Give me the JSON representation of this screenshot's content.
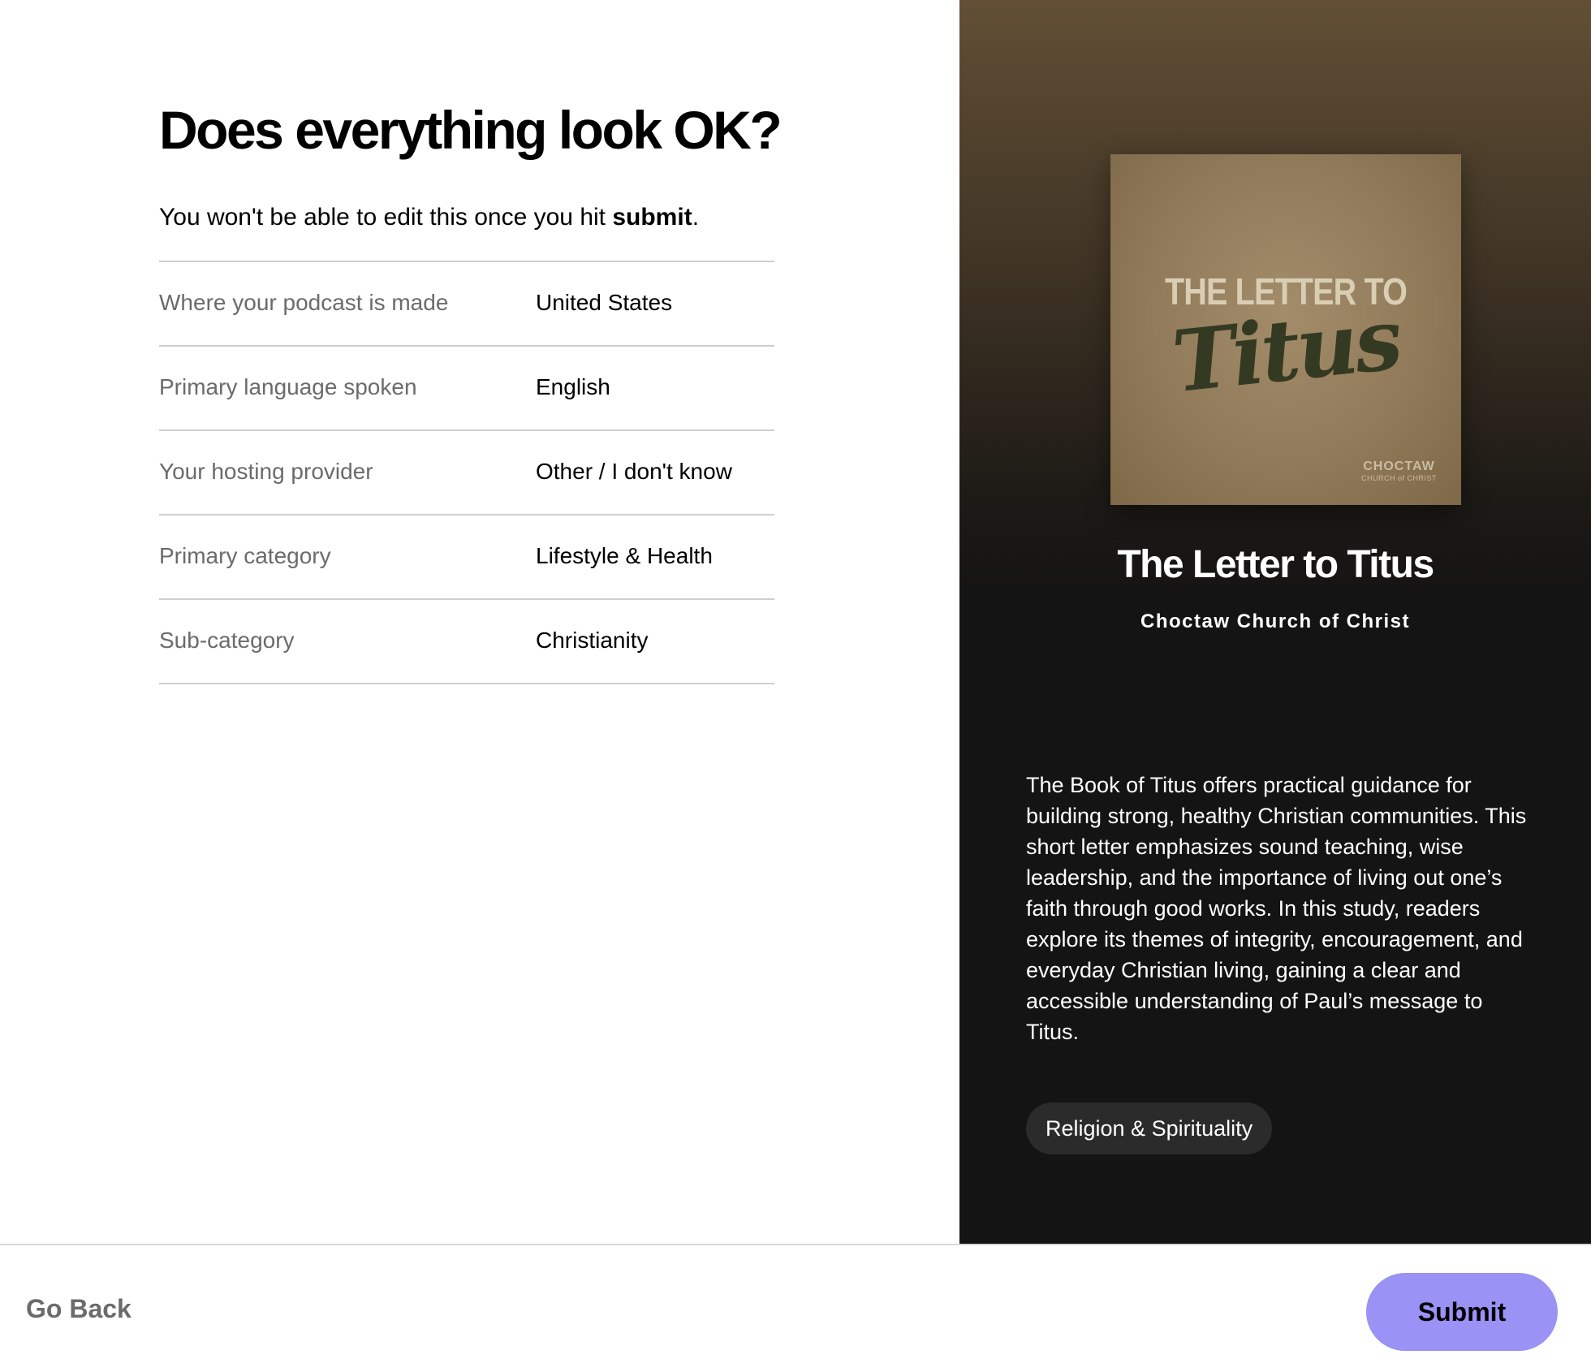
{
  "page": {
    "title": "Does everything look OK?",
    "subtitle_prefix": "You won't be able to edit this once you hit ",
    "subtitle_bold": "submit",
    "subtitle_suffix": "."
  },
  "summary_rows": [
    {
      "label": "Where your podcast is made",
      "value": "United States"
    },
    {
      "label": "Primary language spoken",
      "value": "English"
    },
    {
      "label": "Your hosting provider",
      "value": "Other / I don't know"
    },
    {
      "label": "Primary category",
      "value": "Lifestyle & Health"
    },
    {
      "label": "Sub-category",
      "value": "Christianity"
    }
  ],
  "preview": {
    "cover": {
      "line1": "THE LETTER TO",
      "line2": "Titus",
      "brand_line1": "CHOCTAW",
      "brand_line2": "CHURCH of CHRIST"
    },
    "show_title": "The Letter to Titus",
    "author": "Choctaw Church of Christ",
    "description": "The Book of Titus offers practical guidance for building strong, healthy Christian communities. This short letter emphasizes sound teaching, wise leadership, and the importance of living out one’s faith through good works. In this study, readers explore its themes of integrity, encouragement, and everyday Christian living, gaining a clear and accessible understanding of Paul’s message to Titus.",
    "tag": "Religion & Spirituality"
  },
  "footer": {
    "go_back_label": "Go Back",
    "submit_label": "Submit"
  },
  "colors": {
    "submit_bg": "#9a92f4",
    "panel_dark": "#141414",
    "panel_top": "#624f35",
    "muted_text": "#6b6b6b"
  }
}
